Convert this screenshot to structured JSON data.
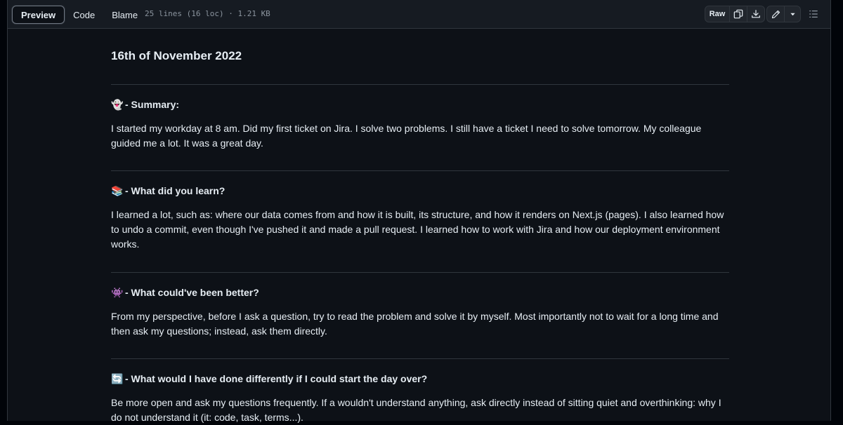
{
  "toolbar": {
    "tabs": [
      {
        "label": "Preview",
        "active": true
      },
      {
        "label": "Code",
        "active": false
      },
      {
        "label": "Blame",
        "active": false
      }
    ],
    "file_meta": "25 lines (16 loc) · 1.21 KB",
    "raw_label": "Raw",
    "icons": [
      "copy-icon",
      "download-icon",
      "pencil-icon",
      "triangle-down-icon",
      "list-icon"
    ]
  },
  "document": {
    "title": "16th of November 2022",
    "sections": [
      {
        "icon": "ghost-emoji",
        "emoji": "👻",
        "heading": "- Summary:",
        "body": "I started my workday at 8 am. Did my first ticket on Jira. I solve two problems. I still have a ticket I need to solve tomorrow. My colleague guided me a lot. It was a great day."
      },
      {
        "icon": "books-emoji",
        "emoji": "📚",
        "heading": "- What did you learn?",
        "body": "I learned a lot, such as: where our data comes from and how it is built, its structure, and how it renders on Next.js (pages). I also learned how to undo a commit, even though I've pushed it and made a pull request. I learned how to work with Jira and how our deployment environment works."
      },
      {
        "icon": "alien-monster-emoji",
        "emoji": "👾",
        "heading": "- What could've been better?",
        "body": "From my perspective, before I ask a question, try to read the problem and solve it by myself. Most importantly not to wait for a long time and then ask my questions; instead, ask them directly."
      },
      {
        "icon": "arrows-counterclockwise-emoji",
        "emoji": "🔄",
        "heading": "- What would I have done differently if I could start the day over?",
        "body": "Be more open and ask my questions frequently. If a wouldn't understand anything, ask directly instead of sitting quiet and overthinking: why I do not understand it (it: code, task, terms...)."
      }
    ]
  },
  "colors": {
    "background": "#0d1117",
    "toolbar": "#161b22",
    "border": "#30363d",
    "text": "#e6edf3",
    "muted": "#8b949e"
  }
}
